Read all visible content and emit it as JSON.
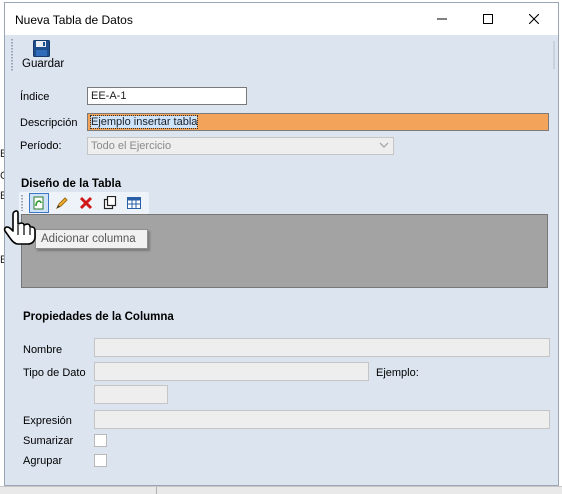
{
  "window": {
    "title": "Nueva Tabla de Datos",
    "controls": {
      "minimize": "minimize-icon",
      "maximize": "maximize-icon",
      "close": "close-icon"
    }
  },
  "toolbar": {
    "save_label": "Guardar",
    "save_icon": "floppy-disk-icon"
  },
  "form": {
    "indice_label": "Índice",
    "indice_value": "EE-A-1",
    "descripcion_label": "Descripción",
    "descripcion_value": "Ejemplo insertar tabla",
    "periodo_label": "Período:",
    "periodo_value": "Todo el Ejercicio"
  },
  "design": {
    "section_title": "Diseño de la Tabla",
    "tools": [
      "add-column-icon",
      "edit-pencil-icon",
      "delete-x-icon",
      "copy-icon",
      "grid-icon"
    ],
    "tooltip": "Adicionar columna"
  },
  "properties": {
    "section_title": "Propiedades de la Columna",
    "nombre_label": "Nombre",
    "tipo_label": "Tipo de Dato",
    "ejemplo_label": "Ejemplo:",
    "expresion_label": "Expresión",
    "sumarizar_label": "Sumarizar",
    "agrupar_label": "Agrupar"
  },
  "background_fragments": [
    "E",
    "C",
    "E",
    "E"
  ],
  "colors": {
    "dialog_bg": "#dbe4ef",
    "highlight_field": "#f4a35a",
    "design_area": "#a3a3a3"
  }
}
